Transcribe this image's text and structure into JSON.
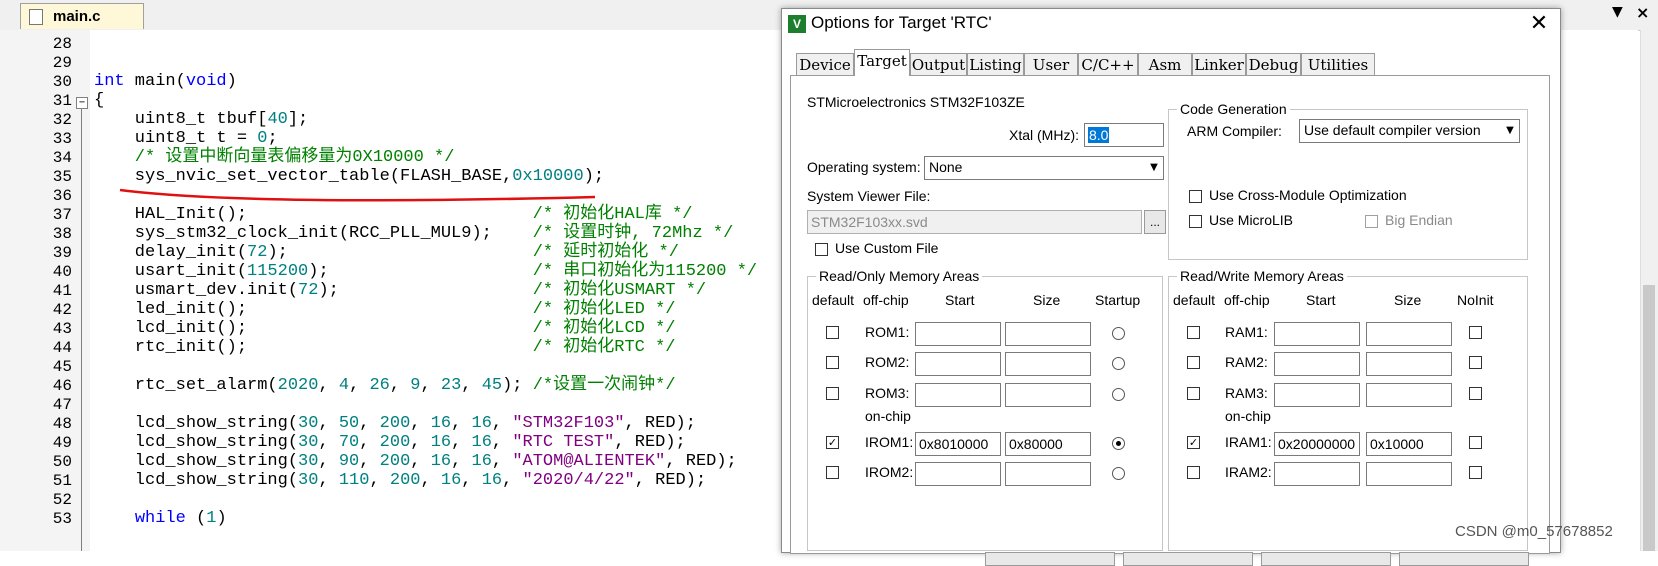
{
  "editor": {
    "tab_label": "main.c",
    "line_numbers": [
      "28",
      "29",
      "30",
      "31",
      "32",
      "33",
      "34",
      "35",
      "36",
      "37",
      "38",
      "39",
      "40",
      "41",
      "42",
      "43",
      "44",
      "45",
      "46",
      "47",
      "48",
      "49",
      "50",
      "51",
      "52",
      "53"
    ],
    "lines": [
      [],
      [],
      [
        {
          "t": "int",
          "c": "kw"
        },
        {
          "t": " main("
        },
        {
          "t": "void",
          "c": "kw"
        },
        {
          "t": ")"
        }
      ],
      [
        {
          "t": "{"
        }
      ],
      [
        {
          "t": "    uint8_t tbuf["
        },
        {
          "t": "40",
          "c": "num"
        },
        {
          "t": "];"
        }
      ],
      [
        {
          "t": "    uint8_t t = "
        },
        {
          "t": "0",
          "c": "num"
        },
        {
          "t": ";"
        }
      ],
      [
        {
          "t": "    /* 设置中断向量表偏移量为0X10000 */",
          "c": "cmt"
        }
      ],
      [
        {
          "t": "    sys_nvic_set_vector_table(FLASH_BASE,"
        },
        {
          "t": "0x10000",
          "c": "num"
        },
        {
          "t": ");"
        }
      ],
      [],
      [
        {
          "t": "    HAL_Init();                            "
        },
        {
          "t": "/* 初始化HAL库 */",
          "c": "cmt"
        }
      ],
      [
        {
          "t": "    sys_stm32_clock_init(RCC_PLL_MUL9);    "
        },
        {
          "t": "/* 设置时钟, 72Mhz */",
          "c": "cmt"
        }
      ],
      [
        {
          "t": "    delay_init("
        },
        {
          "t": "72",
          "c": "num"
        },
        {
          "t": ");                        "
        },
        {
          "t": "/* 延时初始化 */",
          "c": "cmt"
        }
      ],
      [
        {
          "t": "    usart_init("
        },
        {
          "t": "115200",
          "c": "num"
        },
        {
          "t": ");                    "
        },
        {
          "t": "/* 串口初始化为115200 */",
          "c": "cmt"
        }
      ],
      [
        {
          "t": "    usmart_dev.init("
        },
        {
          "t": "72",
          "c": "num"
        },
        {
          "t": ");                   "
        },
        {
          "t": "/* 初始化USMART */",
          "c": "cmt"
        }
      ],
      [
        {
          "t": "    led_init();                            "
        },
        {
          "t": "/* 初始化LED */",
          "c": "cmt"
        }
      ],
      [
        {
          "t": "    lcd_init();                            "
        },
        {
          "t": "/* 初始化LCD */",
          "c": "cmt"
        }
      ],
      [
        {
          "t": "    rtc_init();                            "
        },
        {
          "t": "/* 初始化RTC */",
          "c": "cmt"
        }
      ],
      [],
      [
        {
          "t": "    rtc_set_alarm("
        },
        {
          "t": "2020",
          "c": "num"
        },
        {
          "t": ", "
        },
        {
          "t": "4",
          "c": "num"
        },
        {
          "t": ", "
        },
        {
          "t": "26",
          "c": "num"
        },
        {
          "t": ", "
        },
        {
          "t": "9",
          "c": "num"
        },
        {
          "t": ", "
        },
        {
          "t": "23",
          "c": "num"
        },
        {
          "t": ", "
        },
        {
          "t": "45",
          "c": "num"
        },
        {
          "t": "); "
        },
        {
          "t": "/*设置一次闹钟*/",
          "c": "cmt"
        }
      ],
      [],
      [
        {
          "t": "    lcd_show_string("
        },
        {
          "t": "30",
          "c": "num"
        },
        {
          "t": ", "
        },
        {
          "t": "50",
          "c": "num"
        },
        {
          "t": ", "
        },
        {
          "t": "200",
          "c": "num"
        },
        {
          "t": ", "
        },
        {
          "t": "16",
          "c": "num"
        },
        {
          "t": ", "
        },
        {
          "t": "16",
          "c": "num"
        },
        {
          "t": ", "
        },
        {
          "t": "\"STM32F103\"",
          "c": "str"
        },
        {
          "t": ", RED);"
        }
      ],
      [
        {
          "t": "    lcd_show_string("
        },
        {
          "t": "30",
          "c": "num"
        },
        {
          "t": ", "
        },
        {
          "t": "70",
          "c": "num"
        },
        {
          "t": ", "
        },
        {
          "t": "200",
          "c": "num"
        },
        {
          "t": ", "
        },
        {
          "t": "16",
          "c": "num"
        },
        {
          "t": ", "
        },
        {
          "t": "16",
          "c": "num"
        },
        {
          "t": ", "
        },
        {
          "t": "\"RTC TEST\"",
          "c": "str"
        },
        {
          "t": ", RED);"
        }
      ],
      [
        {
          "t": "    lcd_show_string("
        },
        {
          "t": "30",
          "c": "num"
        },
        {
          "t": ", "
        },
        {
          "t": "90",
          "c": "num"
        },
        {
          "t": ", "
        },
        {
          "t": "200",
          "c": "num"
        },
        {
          "t": ", "
        },
        {
          "t": "16",
          "c": "num"
        },
        {
          "t": ", "
        },
        {
          "t": "16",
          "c": "num"
        },
        {
          "t": ", "
        },
        {
          "t": "\"ATOM@ALIENTEK\"",
          "c": "str"
        },
        {
          "t": ", RED);"
        }
      ],
      [
        {
          "t": "    lcd_show_string("
        },
        {
          "t": "30",
          "c": "num"
        },
        {
          "t": ", "
        },
        {
          "t": "110",
          "c": "num"
        },
        {
          "t": ", "
        },
        {
          "t": "200",
          "c": "num"
        },
        {
          "t": ", "
        },
        {
          "t": "16",
          "c": "num"
        },
        {
          "t": ", "
        },
        {
          "t": "16",
          "c": "num"
        },
        {
          "t": ", "
        },
        {
          "t": "\"2020/4/22\"",
          "c": "str"
        },
        {
          "t": ", RED);"
        }
      ],
      [],
      [
        {
          "t": "    "
        },
        {
          "t": "while",
          "c": "kw"
        },
        {
          "t": " ("
        },
        {
          "t": "1",
          "c": "num"
        },
        {
          "t": ")"
        }
      ]
    ],
    "colors": {
      "keyword": "#0000ff",
      "number": "#008080",
      "string": "#800080",
      "comment": "#008000",
      "annotation": "#e01010"
    }
  },
  "dialog": {
    "title": "Options for Target 'RTC'",
    "close_glyph": "✕",
    "tabs": [
      "Device",
      "Target",
      "Output",
      "Listing",
      "User",
      "C/C++",
      "Asm",
      "Linker",
      "Debug",
      "Utilities"
    ],
    "active_tab": "Target",
    "device_name": "STMicroelectronics STM32F103ZE",
    "xtal_label": "Xtal (MHz):",
    "xtal_value": "8.0",
    "os_label": "Operating system:",
    "os_value": "None",
    "svf_label": "System Viewer File:",
    "svf_value": "STM32F103xx.svd",
    "svf_browse": "...",
    "use_custom_file": "Use Custom File",
    "code_gen": {
      "title": "Code Generation",
      "compiler_label": "ARM Compiler:",
      "compiler_value": "Use default compiler version",
      "cross_module": "Use Cross-Module Optimization",
      "microlib": "Use MicroLIB",
      "big_endian": "Big Endian"
    },
    "rom_group": {
      "title": "Read/Only Memory Areas",
      "headers": [
        "default",
        "off-chip",
        "Start",
        "Size",
        "Startup"
      ],
      "onchip_label": "on-chip",
      "rows": [
        {
          "name": "ROM1:",
          "start": "",
          "size": "",
          "default": false,
          "startup": false
        },
        {
          "name": "ROM2:",
          "start": "",
          "size": "",
          "default": false,
          "startup": false
        },
        {
          "name": "ROM3:",
          "start": "",
          "size": "",
          "default": false,
          "startup": false
        },
        {
          "name": "IROM1:",
          "start": "0x8010000",
          "size": "0x80000",
          "default": true,
          "startup": true
        },
        {
          "name": "IROM2:",
          "start": "",
          "size": "",
          "default": false,
          "startup": false
        }
      ]
    },
    "ram_group": {
      "title": "Read/Write Memory Areas",
      "headers": [
        "default",
        "off-chip",
        "Start",
        "Size",
        "NoInit"
      ],
      "onchip_label": "on-chip",
      "rows": [
        {
          "name": "RAM1:",
          "start": "",
          "size": "",
          "default": false,
          "noinit": false
        },
        {
          "name": "RAM2:",
          "start": "",
          "size": "",
          "default": false,
          "noinit": false
        },
        {
          "name": "RAM3:",
          "start": "",
          "size": "",
          "default": false,
          "noinit": false
        },
        {
          "name": "IRAM1:",
          "start": "0x20000000",
          "size": "0x10000",
          "default": true,
          "noinit": false
        },
        {
          "name": "IRAM2:",
          "start": "",
          "size": "",
          "default": false,
          "noinit": false
        }
      ]
    }
  },
  "watermark": "CSDN @m0_57678852"
}
